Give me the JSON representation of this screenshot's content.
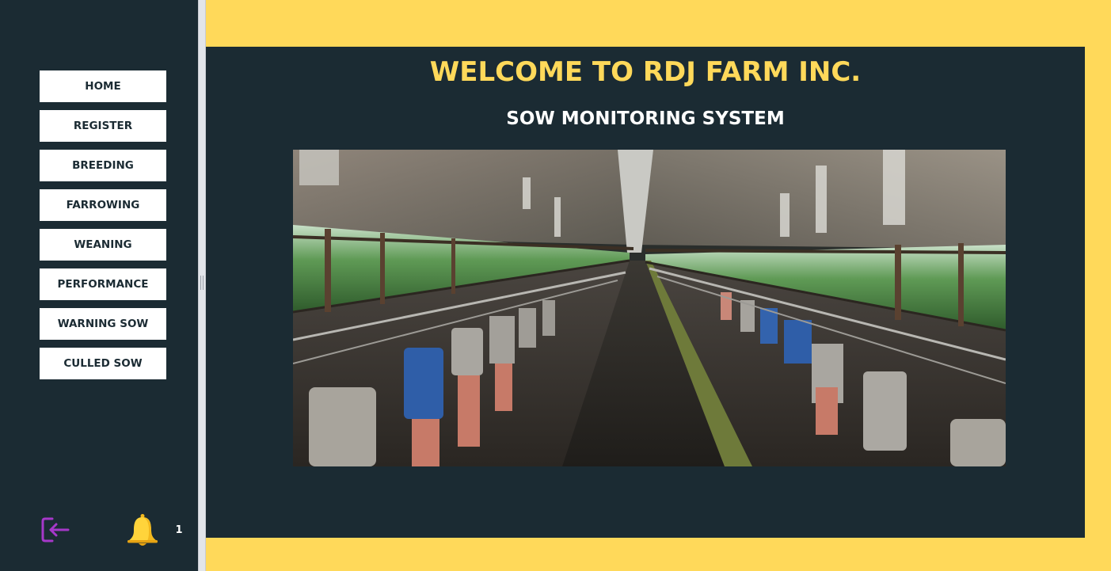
{
  "nav": {
    "items": [
      {
        "label": "HOME"
      },
      {
        "label": "REGISTER"
      },
      {
        "label": "BREEDING"
      },
      {
        "label": "FARROWING"
      },
      {
        "label": "WEANING"
      },
      {
        "label": "PERFORMANCE"
      },
      {
        "label": "WARNING SOW"
      },
      {
        "label": "CULLED SOW"
      }
    ]
  },
  "footer": {
    "logout_icon": "logout-icon",
    "bell_icon": "bell-icon",
    "notification_count": "1"
  },
  "main": {
    "welcome": "WELCOME TO RDJ FARM INC.",
    "subtitle": "SOW MONITORING SYSTEM",
    "photo_icon": "barn-photo"
  },
  "colors": {
    "background_yellow": "#ffd95a",
    "panel_dark": "#1b2b33",
    "button_white": "#ffffff",
    "logout_icon": "#a638c9",
    "bell": "#ffd43b"
  }
}
